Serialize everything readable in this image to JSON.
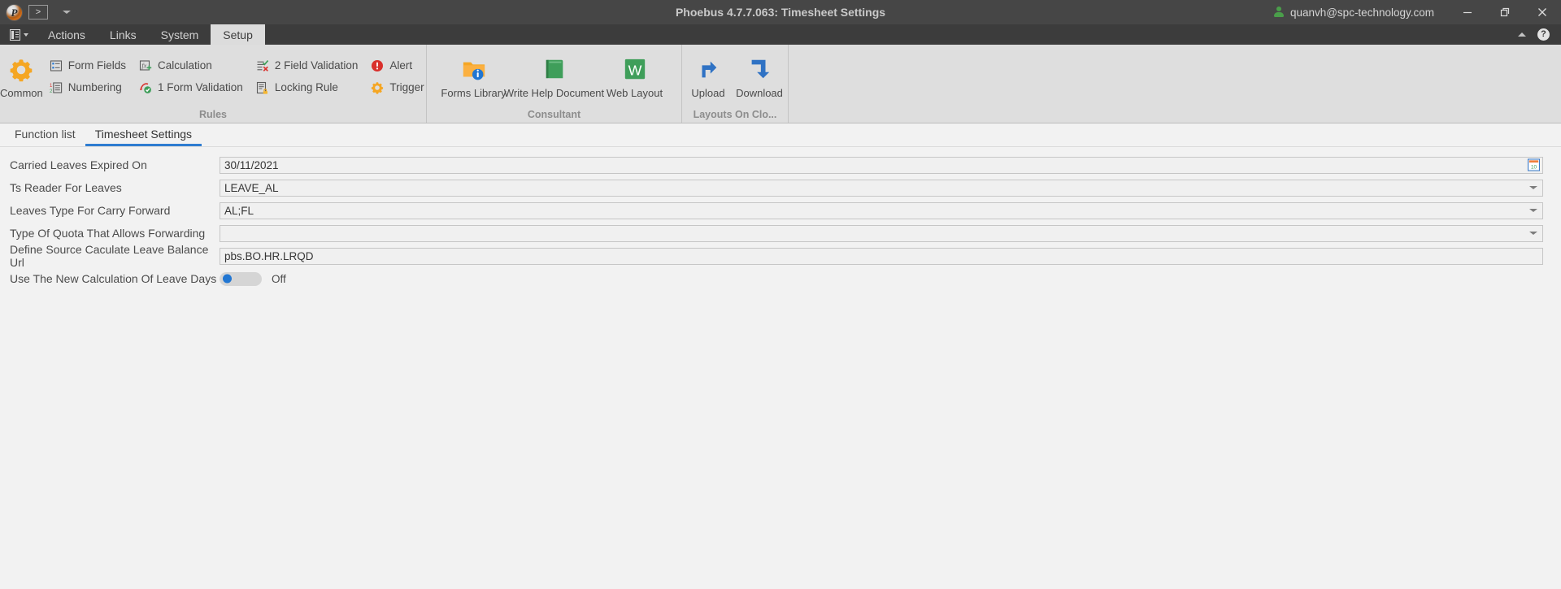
{
  "window": {
    "title": "Phoebus 4.7.7.063: Timesheet Settings",
    "logo_letter": "P",
    "qat_icon": "console-icon",
    "qat_caret": "chevron-down-icon",
    "user_account": "quanvh@spc-technology.com",
    "minimize_label": "Minimize",
    "restore_label": "Restore",
    "close_label": "Close"
  },
  "menubar": {
    "doc_button": "document-menu-button",
    "items": [
      {
        "label": "Actions",
        "active": false
      },
      {
        "label": "Links",
        "active": false
      },
      {
        "label": "System",
        "active": false
      },
      {
        "label": "Setup",
        "active": true
      }
    ],
    "collapse_ribbon": "collapse-ribbon-button",
    "help": "?"
  },
  "ribbon": {
    "groups": [
      {
        "name": "rules",
        "label": "Rules",
        "big_button": {
          "label": "Common",
          "icon": "gear-icon"
        },
        "columns": [
          [
            {
              "label": "Form Fields",
              "icon": "form-fields-icon"
            },
            {
              "label": "Numbering",
              "icon": "numbering-icon"
            }
          ],
          [
            {
              "label": "Calculation",
              "icon": "calculation-icon"
            },
            {
              "label": "1 Form Validation",
              "icon": "form-validation-icon"
            }
          ],
          [
            {
              "label": "2 Field Validation",
              "icon": "field-validation-icon"
            },
            {
              "label": "Locking Rule",
              "icon": "locking-rule-icon"
            }
          ],
          [
            {
              "label": "Alert",
              "icon": "alert-icon"
            },
            {
              "label": "Trigger",
              "icon": "trigger-icon"
            }
          ]
        ]
      },
      {
        "name": "consultant",
        "label": "Consultant",
        "buttons": [
          {
            "label": "Forms Library",
            "icon": "forms-library-icon"
          },
          {
            "label": "Write Help Document",
            "icon": "write-help-document-icon"
          },
          {
            "label": "Web Layout",
            "icon": "web-layout-icon"
          }
        ]
      },
      {
        "name": "layouts-on-cloud",
        "label": "Layouts On Clo...",
        "buttons": [
          {
            "label": "Upload",
            "icon": "upload-icon"
          },
          {
            "label": "Download",
            "icon": "download-icon"
          }
        ]
      }
    ]
  },
  "tabs": [
    {
      "label": "Function list",
      "selected": false
    },
    {
      "label": "Timesheet Settings",
      "selected": true
    }
  ],
  "form": {
    "rows": [
      {
        "label": "Carried Leaves Expired On",
        "type": "date",
        "value": "30/11/2021",
        "placeholder": "",
        "icon": "calendar-icon"
      },
      {
        "label": "Ts Reader For Leaves",
        "type": "select",
        "value": "LEAVE_AL",
        "placeholder": "",
        "icon": "chevron-down-icon"
      },
      {
        "label": "Leaves Type For Carry Forward",
        "type": "select",
        "value": "AL;FL",
        "placeholder": "",
        "icon": "chevron-down-icon"
      },
      {
        "label": "Type Of Quota That Allows Forwarding",
        "type": "select",
        "value": "",
        "placeholder": "",
        "icon": "chevron-down-icon"
      },
      {
        "label": "Define Source Caculate Leave Balance Url",
        "type": "text",
        "value": "pbs.BO.HR.LRQD",
        "placeholder": "",
        "icon": ""
      },
      {
        "label": "Use The New Calculation Of Leave Days",
        "type": "toggle",
        "value": "Off",
        "state": "off",
        "placeholder": "",
        "icon": "toggle-switch"
      }
    ]
  },
  "colors": {
    "titlebar": "#464646",
    "menubar": "#3c3c3c",
    "ribbon": "#dedede",
    "page": "#f2f2f2",
    "accent_blue": "#2e7dd1",
    "toggle_knob": "#2176d2",
    "orange": "#f5a623",
    "green": "#3f9e5a",
    "red": "#d9302c"
  }
}
